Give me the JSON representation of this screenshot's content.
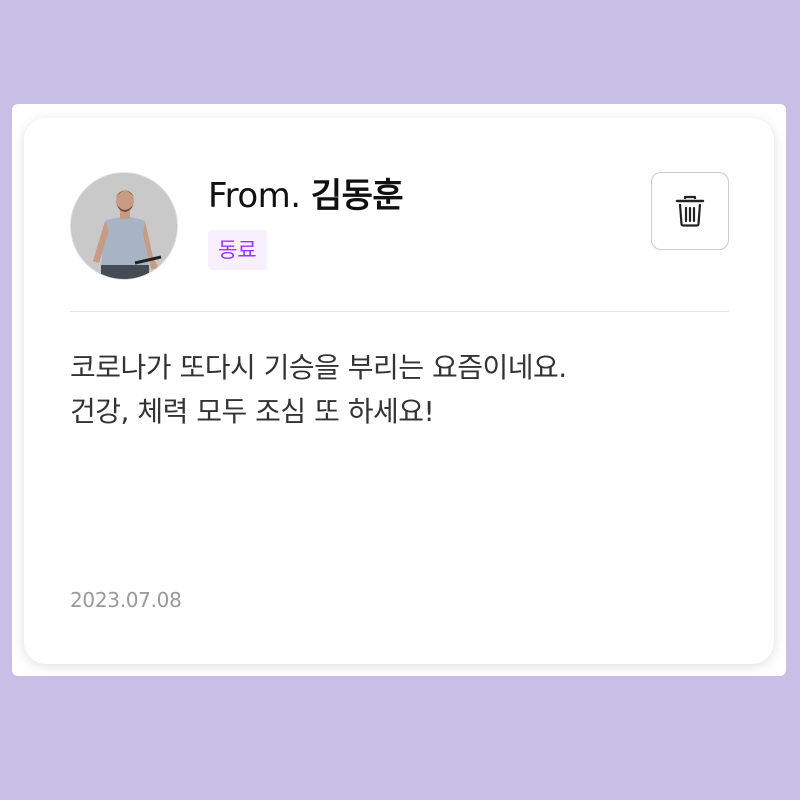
{
  "sender": {
    "prefix": "From.",
    "name": "김동훈",
    "relation": "동료"
  },
  "message": {
    "lines": [
      "코로나가 또다시 기승을 부리는 요즘이네요.",
      "건강, 체력 모두 조심 또 하세요!"
    ]
  },
  "date": "2023.07.08",
  "actions": {
    "delete_icon": "trash-icon"
  },
  "colors": {
    "background": "#c8bfe6",
    "card": "#ffffff",
    "badge_bg": "#f8f0ff",
    "badge_text": "#9935ff",
    "message_text": "#333333",
    "date_text": "#999999"
  }
}
